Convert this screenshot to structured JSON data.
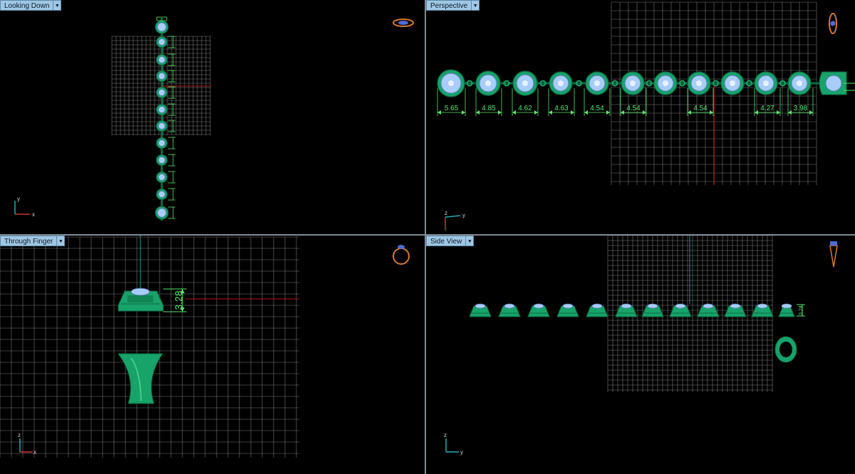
{
  "colors": {
    "viewport_bg": "#000000",
    "grid": "#8a8a8a",
    "x_axis": "#b01818",
    "y_axis": "#1a9a96",
    "metal": "#17a36a",
    "stone": "#a9cdfa",
    "dimension": "#58e86a",
    "tab_bg": "#9fc7e4"
  },
  "viewports": {
    "top_left": {
      "title": "Looking Down",
      "axes": {
        "vertical": "y",
        "horizontal": "x"
      },
      "view_icon": "ring-top-view-icon"
    },
    "top_right": {
      "title": "Perspective",
      "axes": {
        "vertical": "z",
        "horizontal": "y"
      },
      "view_icon": "ring-perspective-icon",
      "dimensions": [
        "5.65",
        "4.85",
        "4.62",
        "4.63",
        "4.54",
        "4.54",
        "4.54",
        "4.27",
        "3.98"
      ]
    },
    "bottom_left": {
      "title": "Through Finger",
      "axes": {
        "vertical": "z",
        "horizontal": "x"
      },
      "view_icon": "ring-front-view-icon",
      "dimension": "3.28"
    },
    "bottom_right": {
      "title": "Side View",
      "axes": {
        "vertical": "z",
        "horizontal": "y"
      },
      "view_icon": "ring-side-view-icon",
      "dimension": "3.24"
    }
  }
}
